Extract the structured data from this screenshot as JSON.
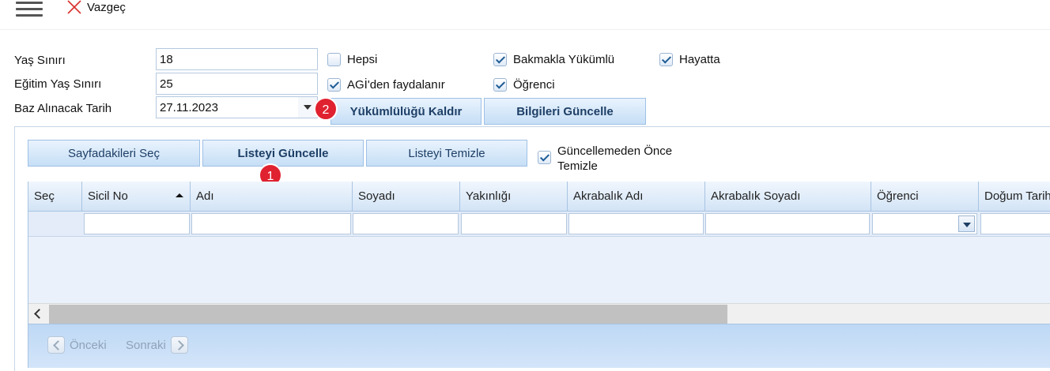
{
  "toolbar": {
    "cancel_label": "Vazgeç"
  },
  "form": {
    "age_limit": {
      "label": "Yaş Sınırı",
      "value": "18"
    },
    "edu_age_limit": {
      "label": "Eğitim Yaş Sınırı",
      "value": "25"
    },
    "base_date": {
      "label": "Baz Alınacak Tarih",
      "value": "27.11.2023"
    }
  },
  "checkboxes": {
    "all": {
      "label": "Hepsi",
      "checked": false
    },
    "agi": {
      "label": "AGİ'den faydalanır",
      "checked": true
    },
    "dependent": {
      "label": "Bakmakla Yükümlü",
      "checked": true
    },
    "student": {
      "label": "Öğrenci",
      "checked": true
    },
    "alive": {
      "label": "Hayatta",
      "checked": true
    },
    "clear_before": {
      "label": "Güncellemeden Önce Temizle",
      "checked": true
    }
  },
  "actions": {
    "remove_obligation": "Yükümlülüğü Kaldır",
    "update_info": "Bilgileri Güncelle",
    "select_page": "Sayfadakileri Seç",
    "update_list": "Listeyi Güncelle",
    "clear_list": "Listeyi Temizle"
  },
  "badges": {
    "first": "1",
    "second": "2"
  },
  "grid": {
    "columns": [
      "Seç",
      "Sicil No",
      "Adı",
      "Soyadı",
      "Yakınlığı",
      "Akrabalık Adı",
      "Akrabalık Soyadı",
      "Öğrenci",
      "Doğum Tarihi"
    ]
  },
  "pager": {
    "prev": "Önceki",
    "next": "Sonraki"
  },
  "colors": {
    "accent": "#1e3f66",
    "badge": "#e0212f",
    "header_bg": "#d3e4f6"
  }
}
